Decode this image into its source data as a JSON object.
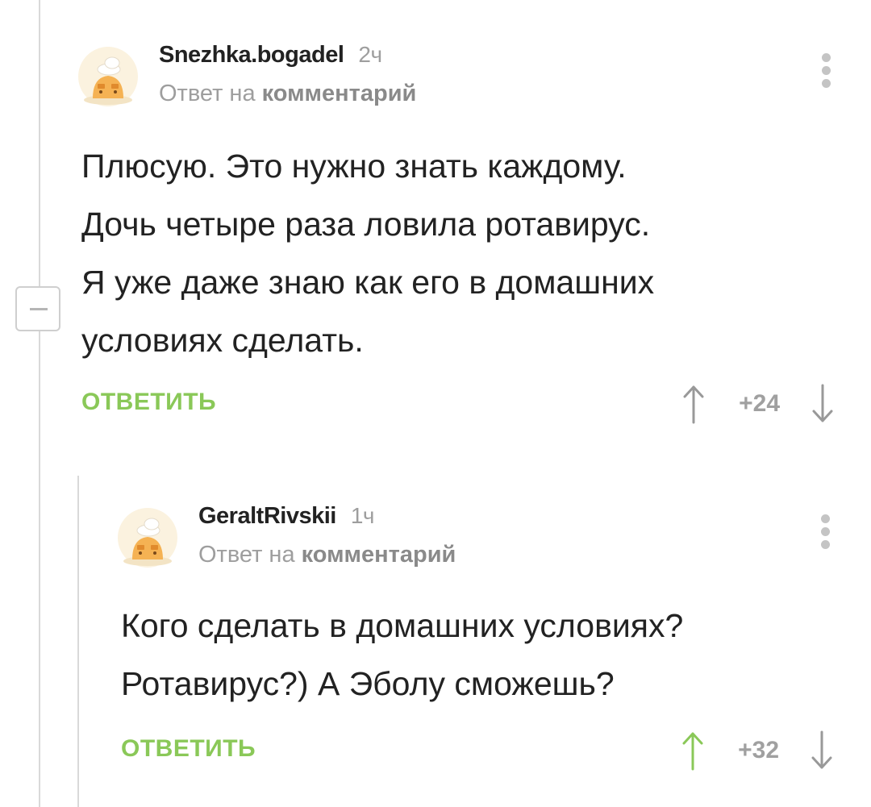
{
  "comments": [
    {
      "author": "Snezhka.bogadel",
      "time": "2ч",
      "reply_prefix": "Ответ на",
      "reply_link": "комментарий",
      "text_lines": [
        "Плюсую. Это нужно знать каждому.",
        "Дочь четыре раза ловила ротавирус.",
        "Я уже даже знаю как его в домашних",
        "условиях сделать."
      ],
      "reply_label": "ОТВЕТИТЬ",
      "rating": "+24",
      "vote_up_color": "#999999"
    },
    {
      "author": "GeraltRivskii",
      "time": "1ч",
      "reply_prefix": "Ответ на",
      "reply_link": "комментарий",
      "text_lines": [
        "Кого сделать в домашних условиях?",
        "Ротавирус?) А Эболу сможешь?"
      ],
      "reply_label": "ОТВЕТИТЬ",
      "rating": "+32",
      "vote_up_color": "#8ac858"
    }
  ],
  "colors": {
    "accent_green": "#8ac858",
    "muted_gray": "#9e9e9e",
    "text": "#222222"
  }
}
